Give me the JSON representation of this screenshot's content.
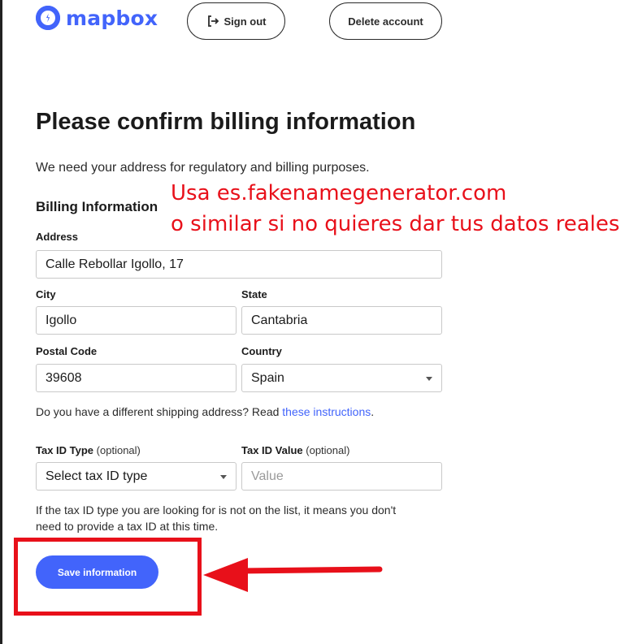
{
  "header": {
    "logo_text": "mapbox",
    "sign_out_label": "Sign out",
    "delete_account_label": "Delete account"
  },
  "page": {
    "title": "Please confirm billing information",
    "intro": "We need your address for regulatory and billing purposes.",
    "section_title": "Billing Information"
  },
  "form": {
    "address": {
      "label": "Address",
      "value": "Calle Rebollar Igollo, 17"
    },
    "city": {
      "label": "City",
      "value": "Igollo"
    },
    "state": {
      "label": "State",
      "value": "Cantabria"
    },
    "postal_code": {
      "label": "Postal Code",
      "value": "39608"
    },
    "country": {
      "label": "Country",
      "value": "Spain"
    },
    "shipping_note": "Do you have a different shipping address? Read ",
    "shipping_link": "these instructions",
    "shipping_note_end": ".",
    "tax_id_type": {
      "label": "Tax ID Type",
      "optional": "(optional)",
      "value": "Select tax ID type"
    },
    "tax_id_value": {
      "label": "Tax ID Value",
      "optional": "(optional)",
      "placeholder": "Value"
    },
    "tax_note_line1": "If the tax ID type you are looking for is not on the list, it means you don't",
    "tax_note_line2": "need to provide a tax ID at this time.",
    "save_label": "Save information"
  },
  "annotation": {
    "line1": "Usa es.fakenamegenerator.com",
    "line2": "o similar si no quieres dar tus datos reales",
    "color": "#e8101a"
  },
  "colors": {
    "brand": "#4264fb"
  }
}
